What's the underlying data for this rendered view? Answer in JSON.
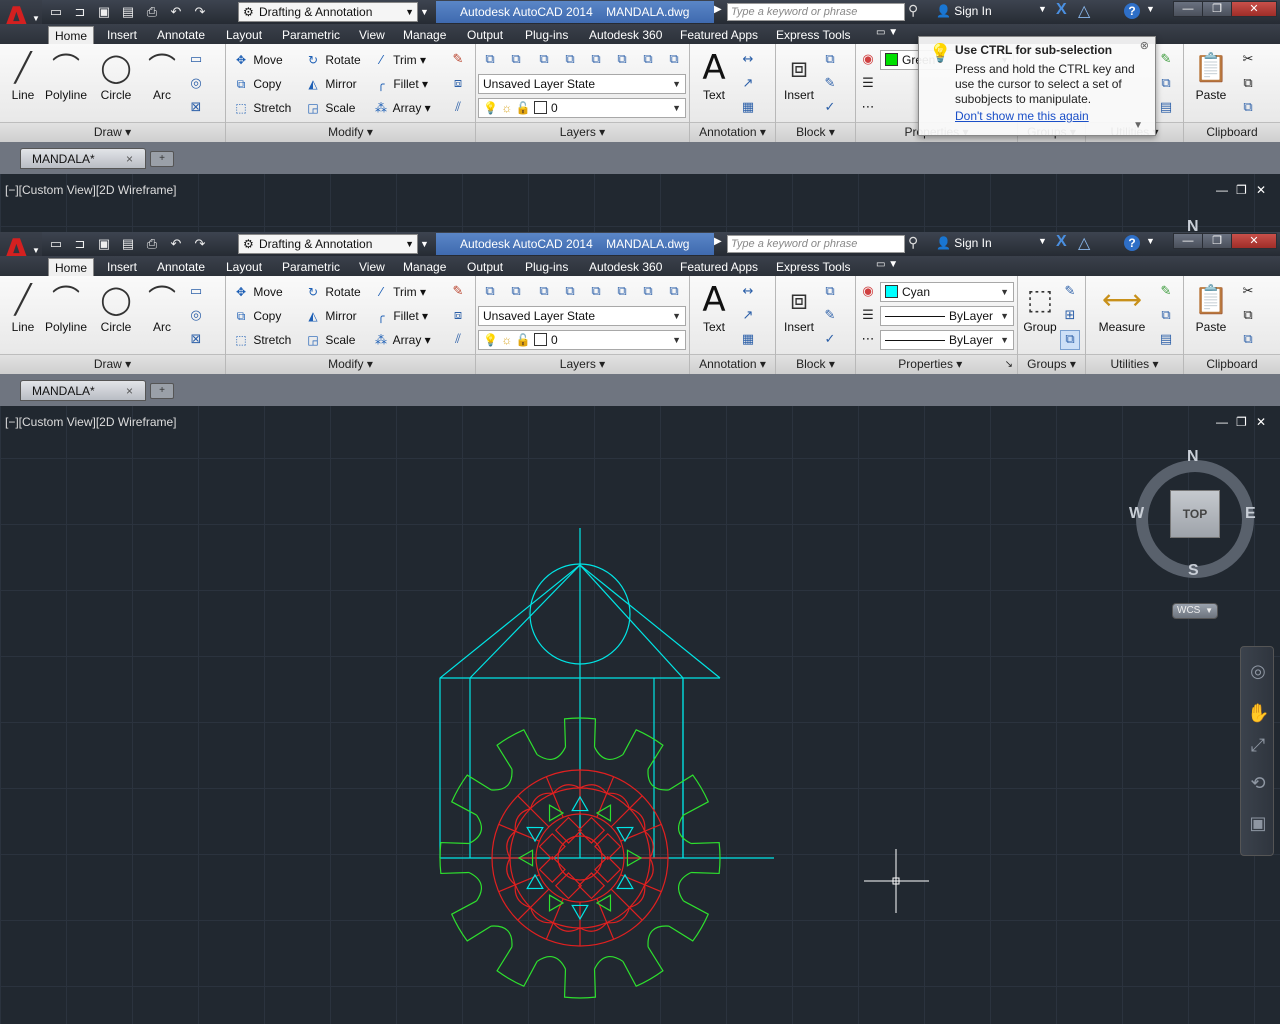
{
  "app": {
    "logo_letter": "A",
    "workspace": "Drafting & Annotation",
    "title": "Autodesk AutoCAD 2014",
    "file": "MANDALA.dwg",
    "search_placeholder": "Type a keyword or phrase",
    "sign_in": "Sign In",
    "help": "?"
  },
  "tabs": [
    "Home",
    "Insert",
    "Annotate",
    "Layout",
    "Parametric",
    "View",
    "Manage",
    "Output",
    "Plug-ins",
    "Autodesk 360",
    "Featured Apps",
    "Express Tools"
  ],
  "ribbon": {
    "draw": {
      "title": "Draw",
      "line": "Line",
      "polyline": "Polyline",
      "circle": "Circle",
      "arc": "Arc"
    },
    "modify": {
      "title": "Modify",
      "move": "Move",
      "rotate": "Rotate",
      "trim": "Trim",
      "copy": "Copy",
      "mirror": "Mirror",
      "fillet": "Fillet",
      "stretch": "Stretch",
      "scale": "Scale",
      "array": "Array"
    },
    "layers": {
      "title": "Layers",
      "state": "Unsaved Layer State",
      "current": "0"
    },
    "annotation": {
      "title": "Annotation",
      "text": "Text"
    },
    "block": {
      "title": "Block",
      "insert": "Insert"
    },
    "properties": {
      "title": "Properties",
      "color_top": "Green",
      "color_top_hex": "#00e000",
      "color_bottom": "Cyan",
      "color_bottom_hex": "#00ffff",
      "linetype": "ByLayer",
      "lineweight": "ByLayer"
    },
    "groups": {
      "title": "Groups",
      "group": "Group"
    },
    "utilities": {
      "title": "Utilities",
      "measure": "Measure"
    },
    "clipboard": {
      "title": "Clipboard",
      "paste": "Paste"
    }
  },
  "doc_tab": {
    "name": "MANDALA*",
    "close": "×"
  },
  "viewport": {
    "label": "[−][Custom View][2D Wireframe]"
  },
  "tooltip": {
    "title": "Use CTRL for sub-selection",
    "body": "Press and hold the CTRL key and use the cursor to select a set of subobjects to manipulate.",
    "link": "Don't show me this again"
  },
  "viewcube": {
    "n": "N",
    "s": "S",
    "e": "E",
    "w": "W",
    "face": "TOP",
    "wcs": "WCS"
  },
  "colors": {
    "drawing_cyan": "#00e5e5",
    "drawing_green": "#2ee02e",
    "drawing_red": "#e02020",
    "accent_blue": "#3f6aaf"
  }
}
